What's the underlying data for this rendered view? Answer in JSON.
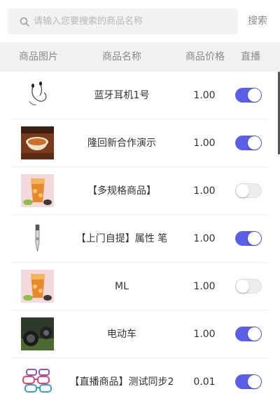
{
  "search": {
    "placeholder": "请输入您要搜索的商品名称",
    "button_label": "搜索"
  },
  "table_header": {
    "image": "商品图片",
    "name": "商品名称",
    "price": "商品价格",
    "live": "直播"
  },
  "colors": {
    "toggle_on": "#5b5fe8",
    "toggle_off": "#eeeeee",
    "header_bg": "#f1f1f1"
  },
  "products": [
    {
      "name": "蓝牙耳机1号",
      "price": "1.00",
      "live": true,
      "thumbnail_icon": "earphone-icon"
    },
    {
      "name": "隆回新合作演示",
      "price": "1.00",
      "live": true,
      "thumbnail_icon": "food-bowl-icon"
    },
    {
      "name": "【多规格商品】",
      "price": "1.00",
      "live": false,
      "thumbnail_icon": "iced-tea-icon"
    },
    {
      "name": "【上门自提】属性 笔",
      "price": "1.00",
      "live": true,
      "thumbnail_icon": "pen-icon"
    },
    {
      "name": "ML",
      "price": "1.00",
      "live": false,
      "thumbnail_icon": "iced-tea-icon"
    },
    {
      "name": "电动车",
      "price": "1.00",
      "live": true,
      "thumbnail_icon": "scooter-icon"
    },
    {
      "name": "【直播商品】测试同步2",
      "price": "0.01",
      "live": true,
      "thumbnail_icon": "glasses-icon"
    }
  ]
}
